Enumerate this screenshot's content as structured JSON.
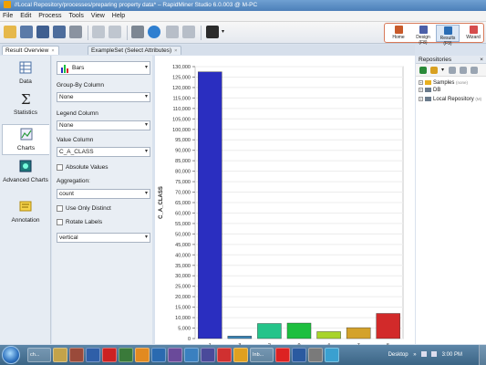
{
  "window": {
    "title": "//Local Repository/processes/preparing property data* – RapidMiner Studio 6.0.003 @ M-PC"
  },
  "menu": [
    "File",
    "Edit",
    "Process",
    "Tools",
    "View",
    "Help"
  ],
  "perspectives": [
    {
      "label": "Home",
      "color": "#c85a2a"
    },
    {
      "label": "Design (F8)",
      "color": "#4b5fa8"
    },
    {
      "label": "Results (F9)",
      "color": "#2a6db5"
    },
    {
      "label": "Wizard",
      "color": "#d64d4d"
    }
  ],
  "tabs": [
    {
      "label": "Result Overview",
      "close": "×"
    },
    {
      "label": "ExampleSet (Select Attributes)",
      "close": "×"
    }
  ],
  "left_nav": [
    {
      "label": "Data",
      "icon": "data-table-icon"
    },
    {
      "label": "Statistics",
      "icon": "sigma-icon"
    },
    {
      "label": "Charts",
      "icon": "chart-icon"
    },
    {
      "label": "Advanced Charts",
      "icon": "advanced-chart-icon"
    },
    {
      "label": "Annotation",
      "icon": "note-icon"
    }
  ],
  "config": {
    "chart_type": "Bars",
    "group_by_label": "Group-By Column",
    "group_by_value": "None",
    "legend_label": "Legend Column",
    "legend_value": "None",
    "value_label": "Value Column",
    "value_value": "C_A_CLASS",
    "absolute_values": "Absolute Values",
    "aggregation_label": "Aggregation:",
    "aggregation_value": "count",
    "use_only_distinct": "Use Only Distinct",
    "rotate_labels": "Rotate Labels",
    "orientation_value": "vertical"
  },
  "repositories": {
    "title": "Repositories",
    "items": [
      {
        "label": "Samples",
        "sub": "(none)",
        "color": "#e8b020"
      },
      {
        "label": "DB",
        "sub": "",
        "color": "#6a7b8c"
      },
      {
        "label": "Local Repository",
        "sub": "(M)",
        "color": "#6a7b8c"
      }
    ]
  },
  "taskbar": {
    "items": [
      "ch...",
      "",
      "",
      "",
      "",
      "",
      "",
      "Inb...",
      "",
      "",
      "",
      ""
    ],
    "desktop": "Desktop",
    "clock": "3:00 PM"
  },
  "chart_data": {
    "type": "bar",
    "ylabel": "C_A_CLASS",
    "ylim": [
      0,
      130000
    ],
    "yticks": [
      0,
      5000,
      10000,
      15000,
      20000,
      25000,
      30000,
      35000,
      40000,
      45000,
      50000,
      55000,
      60000,
      65000,
      70000,
      75000,
      80000,
      85000,
      90000,
      95000,
      100000,
      105000,
      110000,
      115000,
      120000,
      125000,
      130000
    ],
    "ytick_labels": [
      "0",
      "5,000",
      "10,000",
      "15,000",
      "20,000",
      "25,000",
      "30,000",
      "35,000",
      "40,000",
      "45,000",
      "50,000",
      "55,000",
      "60,000",
      "65,000",
      "70,000",
      "75,000",
      "80,000",
      "85,000",
      "90,000",
      "95,000",
      "100,000",
      "105,000",
      "110,000",
      "115,000",
      "120,000",
      "125,000",
      "130,000"
    ],
    "categories": [
      "1",
      "3",
      "2",
      "9",
      "4",
      "7",
      "5"
    ],
    "values": [
      127500,
      1200,
      7200,
      7400,
      3300,
      5200,
      12000
    ],
    "colors": [
      "#2a2ec0",
      "#3a86b8",
      "#25c48a",
      "#1dbf3f",
      "#a8d42a",
      "#d4a22b",
      "#d22a2a"
    ]
  }
}
